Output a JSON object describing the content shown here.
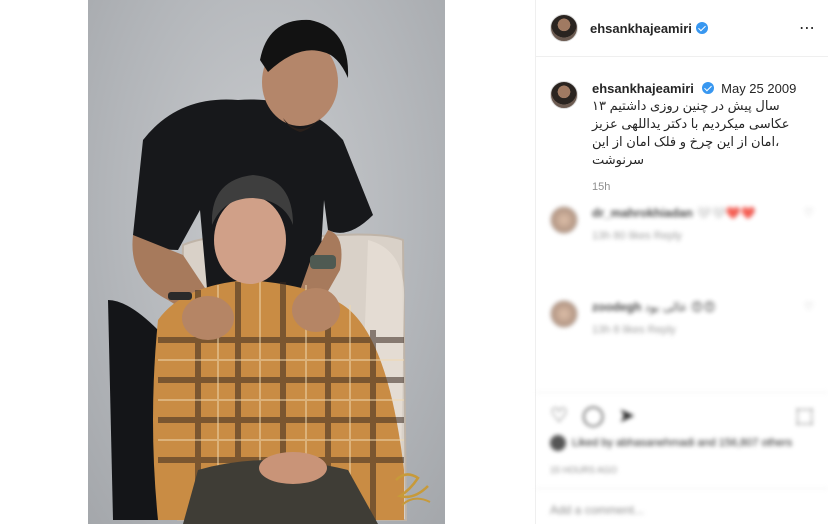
{
  "post": {
    "username": "ehsankhajeamiri",
    "more_icon": "⋯"
  },
  "caption": {
    "username": "ehsankhajeamiri",
    "date": "May 25 2009",
    "text": "سال پیش در چنین روزی داشتیم ۱۳ عکاسی میکردیم با دکتر یداللهی عزیز ،امان از این چرخ و فلک امان از این سرنوشت",
    "time": "15h"
  },
  "comments": [
    {
      "user": "dr_mahrokhiadan",
      "text": "🤍🤍❤️❤️",
      "meta": "13h   80 likes   Reply",
      "like": "♡"
    },
    {
      "user": "zoodegh",
      "text": "عالی بود 😍😍",
      "meta": "13h   8 likes   Reply",
      "like": "♡"
    }
  ],
  "actions": {
    "like_icon": "♡",
    "comment_icon": "◯",
    "share_icon": "➤",
    "save_icon": "⬚",
    "likes_text": "Liked by abhasanehmadi and 156,807 others",
    "ago": "15 HOURS AGO"
  },
  "add_comment": {
    "placeholder": "Add a comment..."
  },
  "photo": {
    "signature_color": "#c79a3a"
  }
}
